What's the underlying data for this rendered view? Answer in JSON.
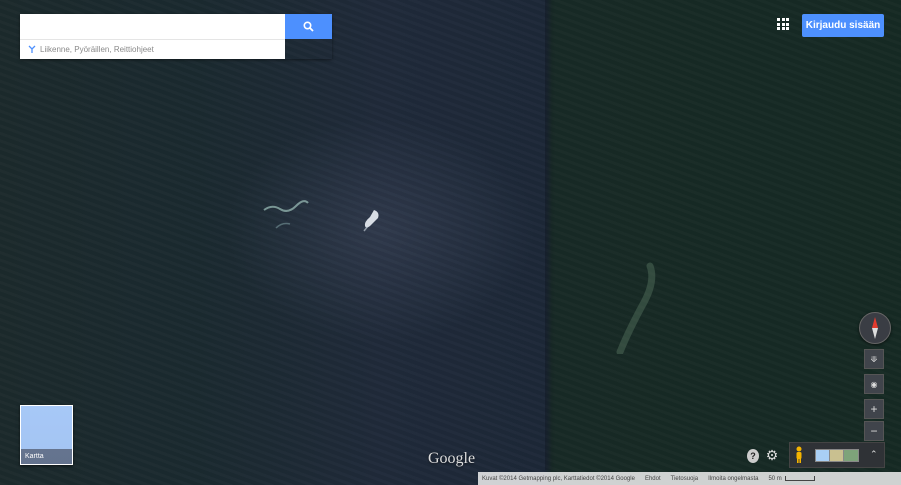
{
  "search": {
    "value": "",
    "placeholder": "",
    "layers_text": "Liikenne, Pyöräillen, Reittiohjeet"
  },
  "header": {
    "signin_label": "Kirjaudu sisään"
  },
  "minimap": {
    "label": "Kartta"
  },
  "logo": "Google",
  "controls": {
    "zoom_in": "+",
    "zoom_out": "−",
    "tilt": "⟱",
    "locate": "◉"
  },
  "attribution": {
    "copyright": "Kuvat ©2014 Getmapping plc, Karttatiedot ©2014 Google",
    "terms": "Ehdot",
    "privacy": "Tietosuoja",
    "report": "Ilmoita ongelmasta",
    "scale": "50 m"
  },
  "icons": {
    "search": "search-icon",
    "apps": "apps-grid-icon",
    "help": "help-icon",
    "gear": "gear-icon",
    "pegman": "pegman-icon",
    "compass": "compass-icon"
  },
  "colors": {
    "accent": "#4d90fe",
    "water": "#1c2a30"
  }
}
